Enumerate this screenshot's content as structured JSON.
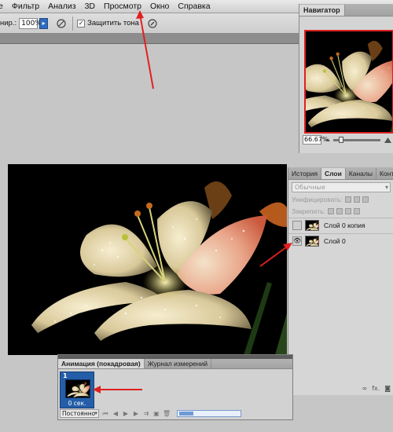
{
  "menubar": {
    "items": [
      "е",
      "Фильтр",
      "Анализ",
      "3D",
      "Просмотр",
      "Окно",
      "Справка"
    ]
  },
  "options": {
    "label": "нир.:",
    "zoom_value": "100%",
    "protect_tones_label": "Защитить тона"
  },
  "navigator": {
    "tab": "Навигатор",
    "zoom": "66.67%"
  },
  "layers": {
    "tabs": [
      "История",
      "Слои",
      "Каналы",
      "Контуры"
    ],
    "blend_mode": "Обычные",
    "unify_label": "Унифицировать:",
    "lock_label": "Закрепить:",
    "items": [
      {
        "name": "Слой 0 копия",
        "visible": false
      },
      {
        "name": "Слой 0",
        "visible": true
      }
    ],
    "footer": "fx."
  },
  "animation": {
    "tabs": [
      "Анимация (покадровая)",
      "Журнал измерений"
    ],
    "frame_number": "1",
    "frame_delay": "0 сек.",
    "loop": "Постоянно"
  },
  "colors": {
    "annotation_arrow": "#e02020",
    "frame_selected": "#245ea8"
  }
}
